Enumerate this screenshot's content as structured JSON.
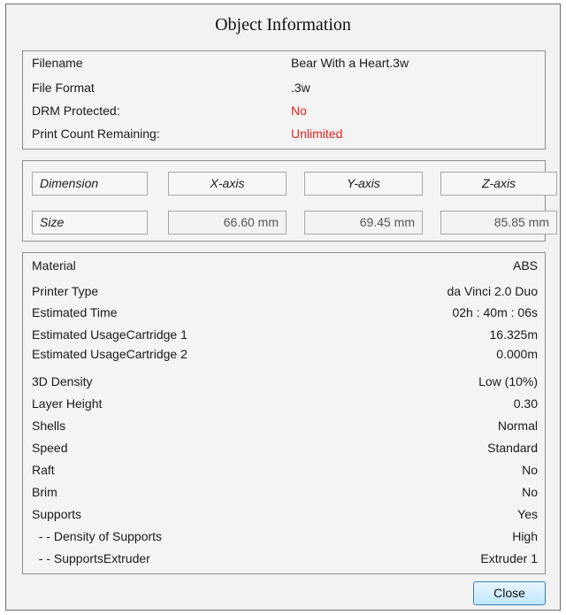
{
  "dialog": {
    "title": "Object Information"
  },
  "file_info": [
    {
      "label": "Filename",
      "value": "Bear With a Heart.3w"
    },
    {
      "label": "File Format",
      "value": ".3w"
    },
    {
      "label": "DRM Protected:",
      "value": "No"
    },
    {
      "label": "Print Count Remaining:",
      "value": "Unlimited"
    }
  ],
  "colors": {
    "alert_red": "#e8221c",
    "button_border": "#3c7fb1"
  },
  "dimensions": {
    "header_label": "Dimension",
    "x_header": "X-axis",
    "y_header": "Y-axis",
    "z_header": "Z-axis",
    "size_label": "Size",
    "x_value": "66.60 mm",
    "y_value": "69.45 mm",
    "z_value": "85.85 mm"
  },
  "properties": [
    {
      "label": "Material",
      "value": "ABS"
    },
    {
      "label": "Printer Type",
      "value": "da Vinci 2.0 Duo"
    },
    {
      "label": "Estimated Time",
      "value": "02h : 40m : 06s"
    },
    {
      "label": "Estimated UsageCartridge 1",
      "value": "16.325m"
    },
    {
      "label": "Estimated UsageCartridge 2",
      "value": "0.000m"
    },
    {
      "label": "3D Density",
      "value": "Low (10%)"
    },
    {
      "label": "Layer Height",
      "value": "0.30"
    },
    {
      "label": "Shells",
      "value": "Normal"
    },
    {
      "label": "Speed",
      "value": "Standard"
    },
    {
      "label": "Raft",
      "value": "No"
    },
    {
      "label": "Brim",
      "value": "No"
    },
    {
      "label": "Supports",
      "value": "Yes"
    },
    {
      "label": "  - - Density of Supports",
      "value": "High"
    },
    {
      "label": "  - - SupportsExtruder",
      "value": "Extruder 1"
    }
  ],
  "buttons": {
    "close_label": "Close"
  }
}
